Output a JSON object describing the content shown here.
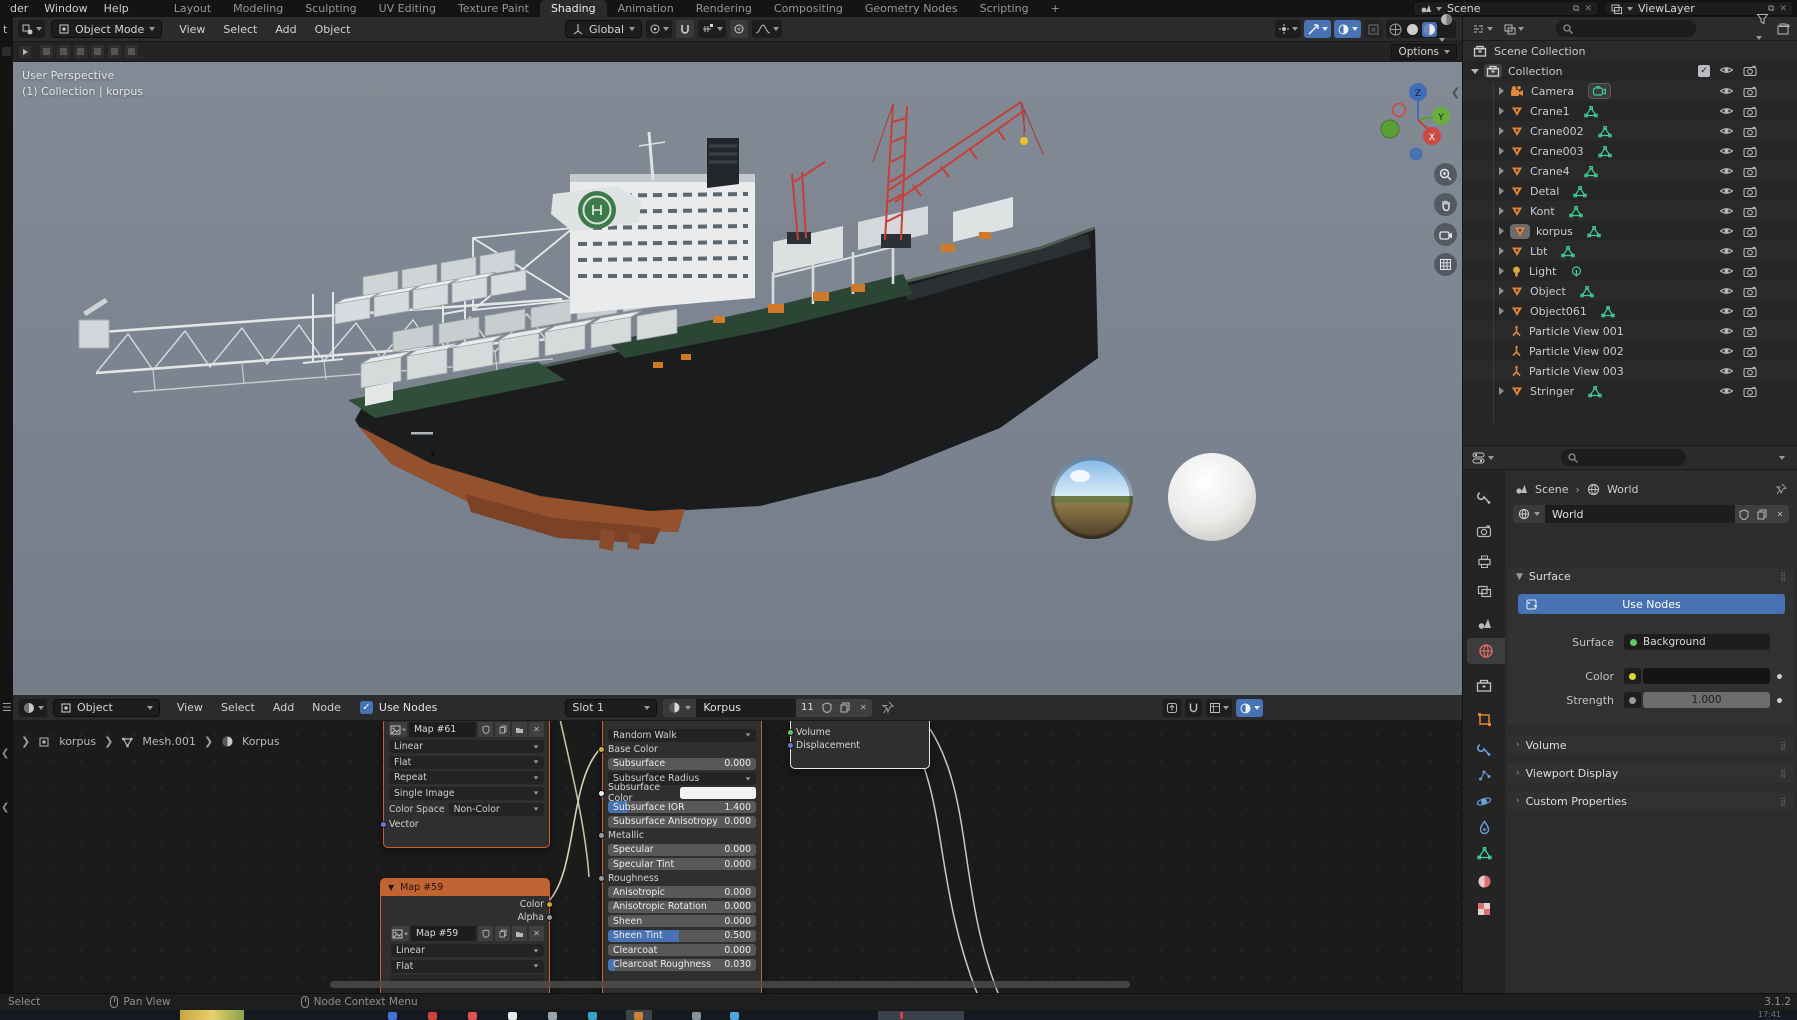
{
  "topbar": {
    "left_menus": [
      "der",
      "Window",
      "Help"
    ],
    "workspaces": [
      "Layout",
      "Modeling",
      "Sculpting",
      "UV Editing",
      "Texture Paint",
      "Shading",
      "Animation",
      "Rendering",
      "Compositing",
      "Geometry Nodes",
      "Scripting",
      "+"
    ],
    "active_workspace": "Shading",
    "scene_selector": {
      "label": "Scene"
    },
    "view_layer_selector": {
      "label": "ViewLayer"
    }
  },
  "viewport_header": {
    "mode": "Object Mode",
    "menus": [
      "View",
      "Select",
      "Add",
      "Object"
    ],
    "orientation": "Global"
  },
  "tool_row": {
    "options_label": "Options"
  },
  "viewport": {
    "overlay_title": "User Perspective",
    "overlay_subtitle": "(1) Collection | korpus",
    "gizmo_axes": {
      "z": "Z",
      "y": "Y",
      "x": "X"
    }
  },
  "outliner": {
    "root_label": "Scene Collection",
    "collection_label": "Collection",
    "items": [
      {
        "name": "Camera",
        "type": "camera",
        "boxed_data": true
      },
      {
        "name": "Crane1",
        "type": "mesh"
      },
      {
        "name": "Crane002",
        "type": "mesh"
      },
      {
        "name": "Crane003",
        "type": "mesh"
      },
      {
        "name": "Crane4",
        "type": "mesh"
      },
      {
        "name": "Detal",
        "type": "mesh"
      },
      {
        "name": "Kont",
        "type": "mesh"
      },
      {
        "name": "korpus",
        "type": "mesh",
        "active": true
      },
      {
        "name": "Lbt",
        "type": "mesh"
      },
      {
        "name": "Light",
        "type": "light"
      },
      {
        "name": "Object",
        "type": "mesh"
      },
      {
        "name": "Object061",
        "type": "mesh"
      },
      {
        "name": "Particle View 001",
        "type": "particle"
      },
      {
        "name": "Particle View 002",
        "type": "particle"
      },
      {
        "name": "Particle View 003",
        "type": "particle"
      },
      {
        "name": "Stringer",
        "type": "mesh"
      }
    ]
  },
  "properties": {
    "breadcrumb": {
      "scene": "Scene",
      "world": "World"
    },
    "datablock_name": "World",
    "tabs": [
      {
        "id": "tool"
      },
      {
        "id": "render"
      },
      {
        "id": "output"
      },
      {
        "id": "view-layer"
      },
      {
        "id": "scene"
      },
      {
        "id": "world",
        "active": true
      },
      {
        "id": "collection"
      },
      {
        "id": "object"
      },
      {
        "id": "modifiers"
      },
      {
        "id": "particles"
      },
      {
        "id": "physics"
      },
      {
        "id": "constraints"
      },
      {
        "id": "object-data"
      },
      {
        "id": "material"
      },
      {
        "id": "texture"
      }
    ],
    "surface_panel": {
      "title": "Surface",
      "use_nodes_label": "Use Nodes",
      "surface_label": "Surface",
      "surface_value": "Background",
      "color_label": "Color",
      "strength_label": "Strength",
      "strength_value": "1.000"
    },
    "collapsed_panels": [
      "Volume",
      "Viewport Display",
      "Custom Properties"
    ]
  },
  "shader_editor": {
    "header": {
      "shader_type": "Object",
      "menus": [
        "View",
        "Select",
        "Add",
        "Node"
      ],
      "use_nodes_label": "Use Nodes",
      "slot": "Slot 1",
      "material_name": "Korpus",
      "users_count": "11"
    },
    "breadcrumb": {
      "object": "korpus",
      "mesh": "Mesh.001",
      "material": "Korpus"
    },
    "map61": {
      "image_name": "Map #61",
      "dropdowns": [
        "Linear",
        "Flat",
        "Repeat",
        "Single Image"
      ],
      "color_space_label": "Color Space",
      "color_space_value": "Non-Color",
      "input_label": "Vector"
    },
    "principled": {
      "rows": [
        {
          "label": "Random Walk",
          "kind": "dropdown"
        },
        {
          "label": "Base Color",
          "kind": "input",
          "socket": "#c8b035"
        },
        {
          "label": "Subsurface",
          "value": "0.000",
          "kind": "slider",
          "fill": 0
        },
        {
          "label": "Subsurface Radius",
          "kind": "dropdown"
        },
        {
          "label": "Subsurface Color",
          "kind": "color",
          "swatch": "#f2f2f2"
        },
        {
          "label": "Subsurface IOR",
          "value": "1.400",
          "kind": "slider",
          "fill": 0.13
        },
        {
          "label": "Subsurface Anisotropy",
          "value": "0.000",
          "kind": "slider",
          "fill": 0
        },
        {
          "label": "Metallic",
          "kind": "input",
          "socket": "#9a9a9a"
        },
        {
          "label": "Specular",
          "value": "0.000",
          "kind": "slider",
          "fill": 0
        },
        {
          "label": "Specular Tint",
          "value": "0.000",
          "kind": "slider",
          "fill": 0
        },
        {
          "label": "Roughness",
          "kind": "input",
          "socket": "#9a9a9a"
        },
        {
          "label": "Anisotropic",
          "value": "0.000",
          "kind": "slider",
          "fill": 0
        },
        {
          "label": "Anisotropic Rotation",
          "value": "0.000",
          "kind": "slider",
          "fill": 0
        },
        {
          "label": "Sheen",
          "value": "0.000",
          "kind": "slider",
          "fill": 0
        },
        {
          "label": "Sheen Tint",
          "value": "0.500",
          "kind": "slider",
          "fill": 0.48
        },
        {
          "label": "Clearcoat",
          "value": "0.000",
          "kind": "slider",
          "fill": 0
        },
        {
          "label": "Clearcoat Roughness",
          "value": "0.030",
          "kind": "slider",
          "fill": 0.05
        }
      ]
    },
    "output_node": {
      "inputs": [
        {
          "label": "Volume",
          "socket": "#63c763"
        },
        {
          "label": "Displacement",
          "socket": "#7077d8"
        }
      ]
    },
    "map59": {
      "title": "Map #59",
      "outputs": [
        {
          "label": "Color",
          "socket": "#c8b035"
        },
        {
          "label": "Alpha",
          "socket": "#9a9a9a"
        }
      ],
      "image_name": "Map #59",
      "dropdowns": [
        "Linear",
        "Flat"
      ]
    }
  },
  "status_bar": {
    "left": "Select",
    "hints": [
      {
        "label": "Pan View"
      },
      {
        "label": "Node Context Menu"
      }
    ],
    "version": "3.1.2"
  },
  "left_strip": {
    "cut_char": "t"
  },
  "colors": {
    "accent": "#4772b3",
    "node_select_border": "#cf5b2e",
    "node_header_orange": "#c06433",
    "mesh_icon_orange": "#e0883a",
    "data_icon_green": "#3fcf96"
  }
}
